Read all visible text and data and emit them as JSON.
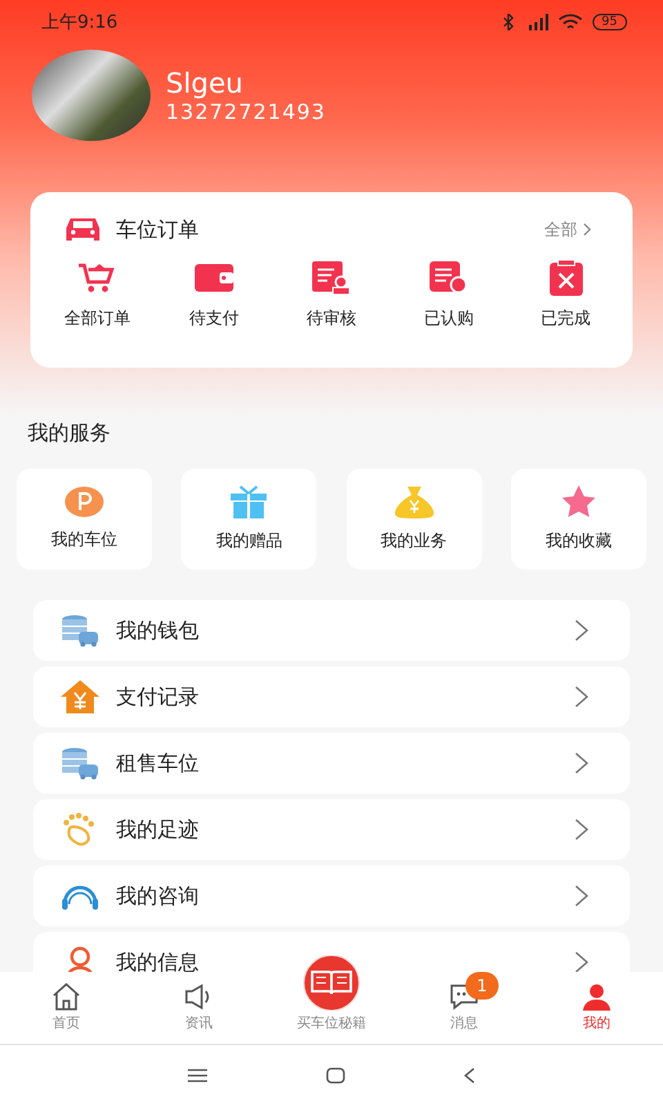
{
  "status_bar": {
    "time": "上午9:16",
    "battery": "95"
  },
  "profile": {
    "name": "Slgeu",
    "phone": "13272721493"
  },
  "orders": {
    "title": "车位订单",
    "more": "全部",
    "items": [
      {
        "label": "全部订单"
      },
      {
        "label": "待支付"
      },
      {
        "label": "待审核"
      },
      {
        "label": "已认购"
      },
      {
        "label": "已完成"
      }
    ]
  },
  "services": {
    "title": "我的服务",
    "items": [
      {
        "label": "我的车位"
      },
      {
        "label": "我的赠品"
      },
      {
        "label": "我的业务"
      },
      {
        "label": "我的收藏"
      }
    ]
  },
  "menu": [
    {
      "label": "我的钱包"
    },
    {
      "label": "支付记录"
    },
    {
      "label": "租售车位"
    },
    {
      "label": "我的足迹"
    },
    {
      "label": "我的咨询"
    },
    {
      "label": "我的信息"
    }
  ],
  "tabs": [
    {
      "label": "首页",
      "selected": false
    },
    {
      "label": "资讯",
      "selected": false
    },
    {
      "label": "买车位秘籍",
      "selected": false
    },
    {
      "label": "消息",
      "selected": false,
      "badge": "1"
    },
    {
      "label": "我的",
      "selected": true
    }
  ]
}
